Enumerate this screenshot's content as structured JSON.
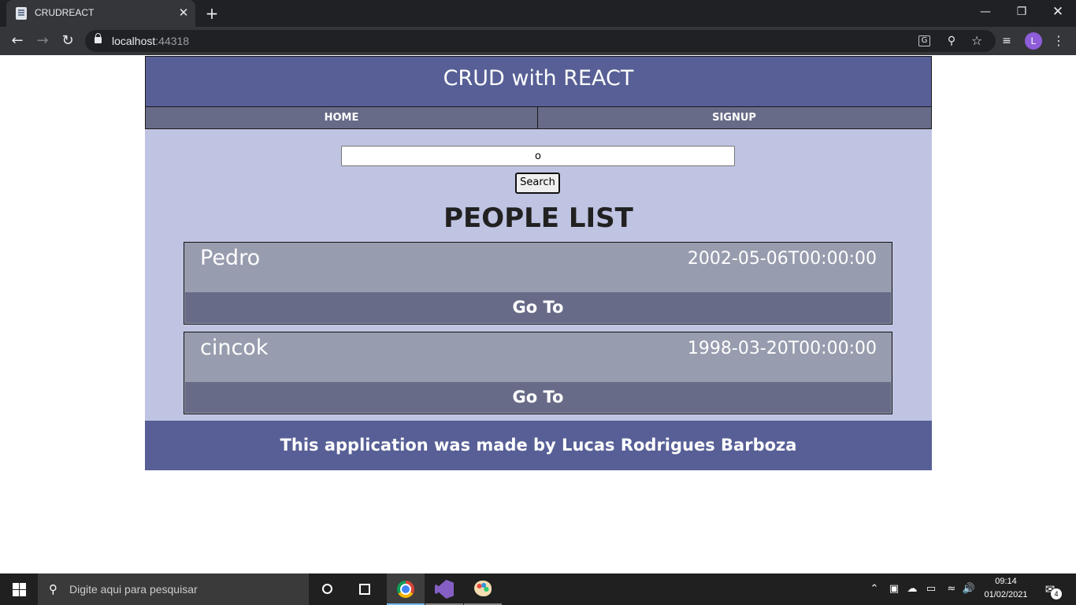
{
  "browser": {
    "tab_title": "CRUDREACT",
    "tab_close": "✕",
    "new_tab": "+",
    "url_host": "localhost",
    "url_port": ":44318",
    "avatar_letter": "L",
    "window_controls": {
      "minimize": "—",
      "maximize": "❐",
      "close": "✕"
    },
    "icons": {
      "back": "arrow-left-icon",
      "forward": "arrow-right-icon",
      "reload": "reload-icon",
      "lock": "lock-icon",
      "translate": "translate-icon",
      "zoom": "zoom-icon",
      "bookmark": "star-icon",
      "media": "media-queue-icon",
      "menu": "more-vert-icon"
    }
  },
  "app": {
    "title": "CRUD with REACT",
    "nav": {
      "home": "HOME",
      "signup": "SIGNUP"
    },
    "search": {
      "value": "o",
      "button_label": "Search"
    },
    "list_title": "PEOPLE LIST",
    "people": [
      {
        "name": "Pedro",
        "date": "2002-05-06T00:00:00",
        "button_label": "Go To"
      },
      {
        "name": "cincok",
        "date": "1998-03-20T00:00:00",
        "button_label": "Go To"
      }
    ],
    "footer": "This application was made by Lucas Rodrigues Barboza",
    "colors": {
      "header": "#575f96",
      "nav": "#676b87",
      "body": "#c0c4e3",
      "card": "#979cae",
      "card_button": "#676b87"
    }
  },
  "taskbar": {
    "search_placeholder": "Digite aqui para pesquisar",
    "time": "09:14",
    "date": "01/02/2021",
    "notification_count": "4",
    "apps": [
      "chrome-icon",
      "visual-studio-icon",
      "paint-icon"
    ]
  }
}
